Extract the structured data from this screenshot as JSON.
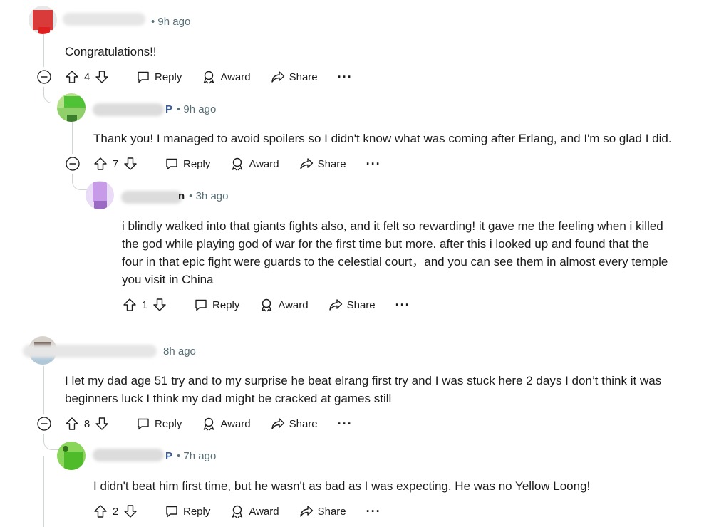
{
  "comments": [
    {
      "time": "• 9h ago",
      "name_suffix": "",
      "text": "Congratulations!!",
      "votes": "4",
      "actions": {
        "reply": "Reply",
        "award": "Award",
        "share": "Share",
        "more": "···"
      }
    },
    {
      "time": "• 9h ago",
      "name_suffix": "P",
      "text": "Thank you! I managed to avoid spoilers so I didn't know what was coming after Erlang, and I'm so glad I did.",
      "votes": "7",
      "actions": {
        "reply": "Reply",
        "award": "Award",
        "share": "Share",
        "more": "···"
      }
    },
    {
      "time": "• 3h ago",
      "name_suffix": "n",
      "text_lines": [
        "i blindly walked into that giants fights also, and it felt so rewarding! it gave me the feeling when i killed",
        "the god while playing god of war for the first time but more. after this i looked up and found that the",
        "four in that epic fight were guards to the celestial court，and you can see them in almost every temple",
        "you visit in China"
      ],
      "votes": "1",
      "actions": {
        "reply": "Reply",
        "award": "Award",
        "share": "Share",
        "more": "···"
      }
    },
    {
      "time": "8h ago",
      "name_suffix": "",
      "text_lines": [
        "I let my dad age 51 try and to my surprise he beat elrang first try and I was stuck here 2 days I don’t think it was",
        "beginners luck I think my dad might be cracked at games still"
      ],
      "votes": "8",
      "actions": {
        "reply": "Reply",
        "award": "Award",
        "share": "Share",
        "more": "···"
      }
    },
    {
      "time": "• 7h ago",
      "name_suffix": "P",
      "text": "I didn't beat him first time, but he wasn't as bad as I was expecting. He was no Yellow Loong!",
      "votes": "2",
      "actions": {
        "reply": "Reply",
        "award": "Award",
        "share": "Share",
        "more": "···"
      }
    }
  ],
  "colors": {
    "text": "#1c1c1c",
    "meta": "#576f76",
    "thread": "#d0d6d8"
  }
}
